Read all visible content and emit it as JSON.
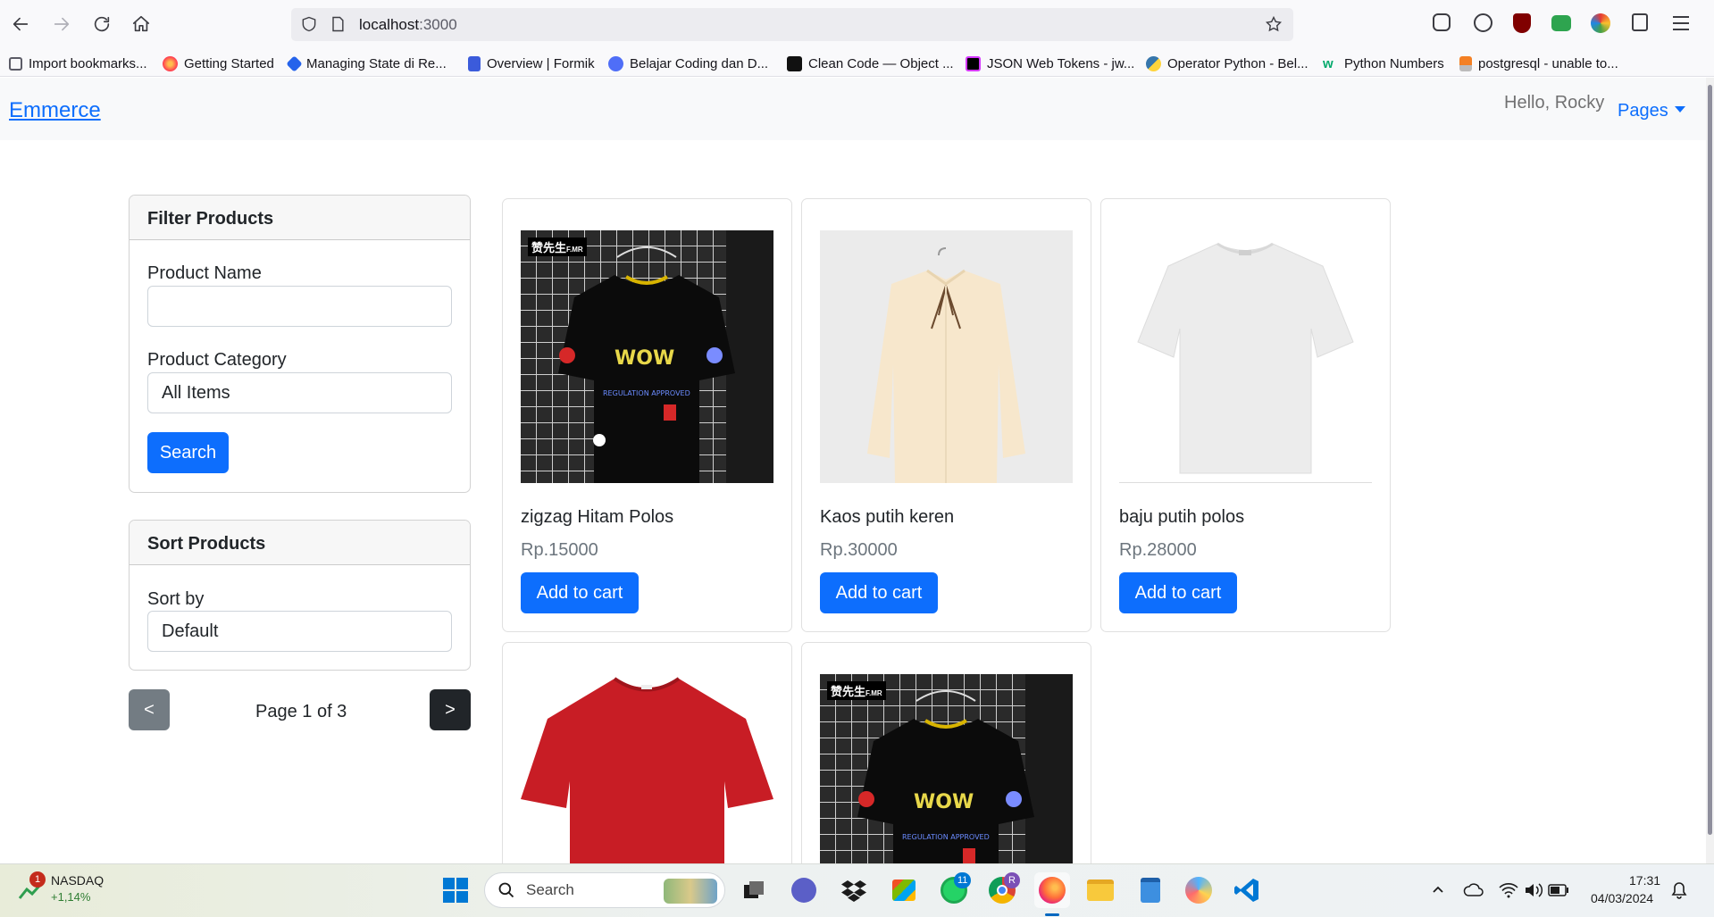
{
  "browser": {
    "url_host": "localhost",
    "url_port": ":3000",
    "bookmarks": [
      "Import bookmarks...",
      "Getting Started",
      "Managing State di Re...",
      "Overview | Formik",
      "Belajar Coding dan D...",
      "Clean Code — Object ...",
      "JSON Web Tokens - jw...",
      "Operator Python - Bel...",
      "Python Numbers",
      "postgresql - unable to..."
    ]
  },
  "navbar": {
    "brand": "Emmerce",
    "greeting": "Hello, Rocky",
    "pages_label": "Pages"
  },
  "filter": {
    "title": "Filter Products",
    "name_label": "Product Name",
    "name_value": "",
    "category_label": "Product Category",
    "category_value": "All Items",
    "search_button": "Search"
  },
  "sort": {
    "title": "Sort Products",
    "sort_label": "Sort by",
    "sort_value": "Default"
  },
  "pagination": {
    "prev": "<",
    "next": ">",
    "info": "Page 1 of 3"
  },
  "products": [
    {
      "name": "zigzag Hitam Polos",
      "price": "Rp.15000",
      "button": "Add to cart"
    },
    {
      "name": "Kaos putih keren",
      "price": "Rp.30000",
      "button": "Add to cart"
    },
    {
      "name": "baju putih polos",
      "price": "Rp.28000",
      "button": "Add to cart"
    },
    {
      "name": "",
      "price": "",
      "button": ""
    },
    {
      "name": "",
      "price": "",
      "button": ""
    }
  ],
  "image_text": {
    "brand_tag": "赞先生",
    "brand_tag_small": "F.MR"
  },
  "taskbar": {
    "stock_name": "NASDAQ",
    "stock_change": "+1,14%",
    "stock_badge": "1",
    "search_placeholder": "Search",
    "whatsapp_badge": "11",
    "chrome_badge": "R",
    "time": "17:31",
    "date": "04/03/2024"
  },
  "colors": {
    "primary": "#0d6efd",
    "secondary": "#6c757d",
    "dark": "#212529"
  }
}
